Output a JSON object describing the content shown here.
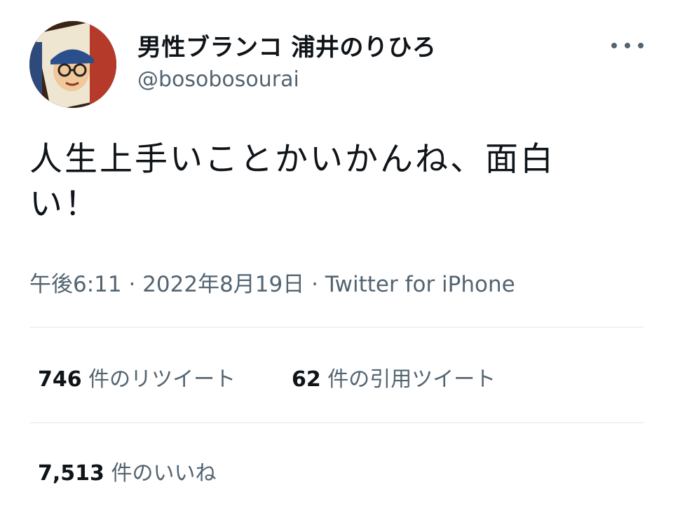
{
  "author": {
    "display_name": "男性ブランコ 浦井のりひろ",
    "handle": "@bosobosourai"
  },
  "tweet": {
    "text": "人生上手いことかいかんね、面白い！",
    "time": "午後6:11",
    "date": "2022年8月19日",
    "source": "Twitter for iPhone",
    "separator": " · "
  },
  "stats": {
    "retweets_count": "746",
    "retweets_label": " 件のリツイート",
    "quotes_count": "62",
    "quotes_label": " 件の引用ツイート",
    "likes_count": "7,513",
    "likes_label": " 件のいいね"
  },
  "icons": {
    "more": "more-horizontal-icon"
  }
}
